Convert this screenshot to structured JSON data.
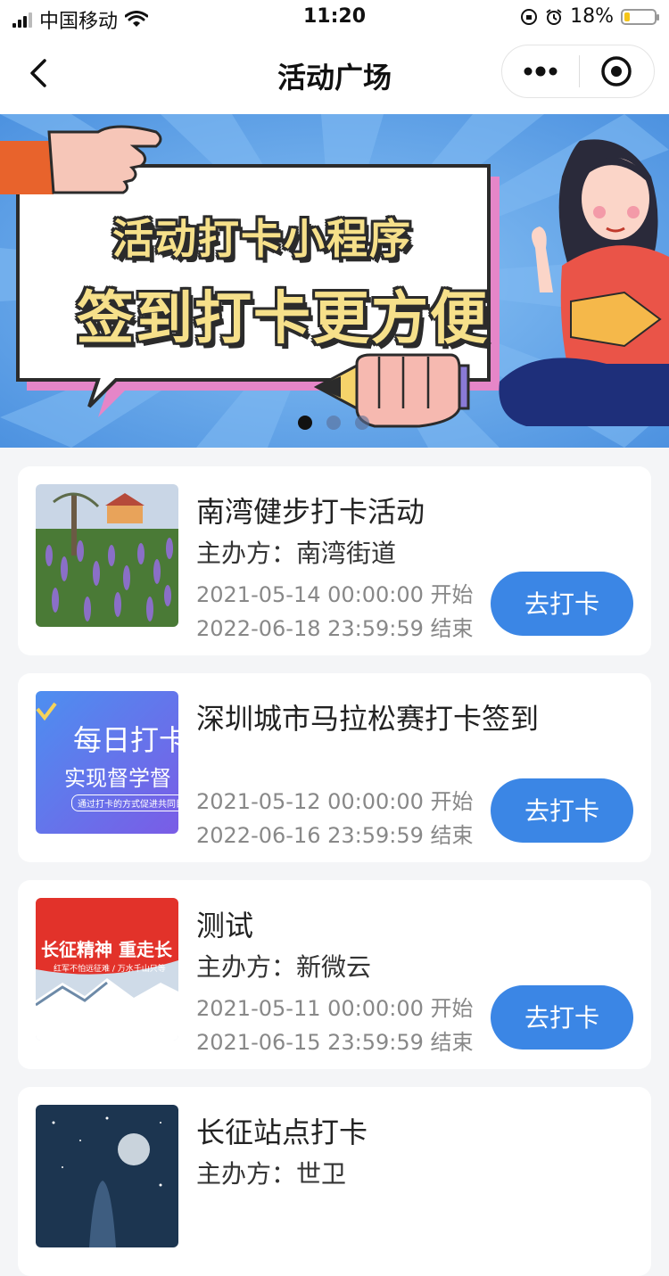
{
  "status_bar": {
    "carrier": "中国移动",
    "time": "11:20",
    "battery": "18%",
    "battery_level": 0.18
  },
  "nav": {
    "title": "活动广场"
  },
  "banner": {
    "title_line1": "活动打卡小程序",
    "title_line2": "签到打卡更方便",
    "dots": 3,
    "active_dot": 0
  },
  "activities": [
    {
      "title": "南湾健步打卡活动",
      "organizer": "主办方：南湾街道",
      "start": "2021-05-14 00:00:00 开始",
      "end": "2022-06-18 23:59:59 结束",
      "button": "去打卡"
    },
    {
      "title": "深圳城市马拉松赛打卡签到",
      "organizer": "",
      "start": "2021-05-12 00:00:00 开始",
      "end": "2022-06-16 23:59:59 结束",
      "button": "去打卡",
      "thumb_line1": "每日打卡",
      "thumb_line2": "实现督学督",
      "thumb_line3": "通过打卡的方式促进共同目标"
    },
    {
      "title": "测试",
      "organizer": "主办方：新微云",
      "start": "2021-05-11 00:00:00 开始",
      "end": "2021-06-15 23:59:59 结束",
      "button": "去打卡",
      "thumb_line1": "长征精神 重走长",
      "thumb_line2": "红军不怕远征难 / 万水千山只等"
    },
    {
      "title": "长征站点打卡",
      "organizer": "主办方：世卫"
    }
  ],
  "colors": {
    "accent": "#3b86e5",
    "banner_bg": "#5aa0e8"
  }
}
